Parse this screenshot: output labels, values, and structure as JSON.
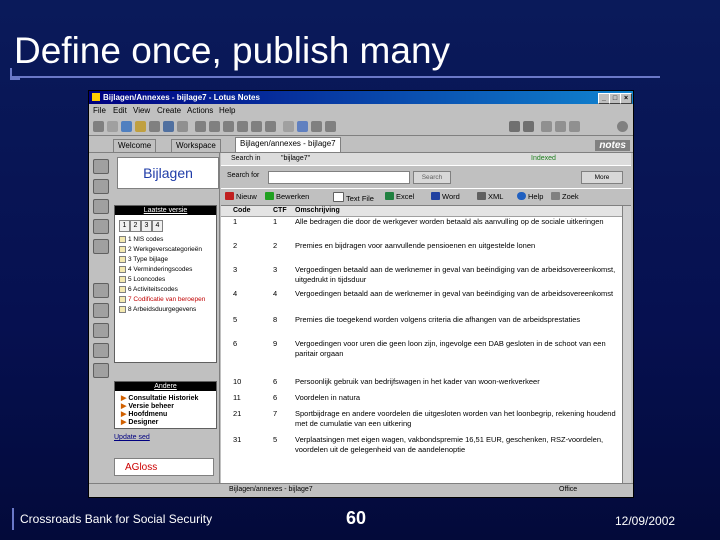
{
  "slide": {
    "title": "Define once, publish many",
    "footer_left": "Crossroads Bank for Social Security",
    "page_number": "60",
    "date": "12/09/2002"
  },
  "window": {
    "title": "Bijlagen/Annexes - bijlage7 - Lotus Notes",
    "menu": [
      "File",
      "Edit",
      "View",
      "Create",
      "Actions",
      "Help"
    ],
    "brand": "notes",
    "tabs": [
      "Welcome",
      "Workspace",
      "Bijlagen/annexes - bijlage7"
    ]
  },
  "nav": {
    "logo": "Bijlagen",
    "panel_title": "Laatste versie",
    "vtabs": [
      "1",
      "2",
      "3",
      "4"
    ],
    "items": [
      "1 NIS codes",
      "2 Werkgeverscategorieën",
      "3 Type bijlage",
      "4 Verminderingscodes",
      "5 Looncodes",
      "6 Activiteitscodes",
      "7 Codificatie van beroepen",
      "8 Arbeidsduurgegevens"
    ],
    "other_title": "Andere",
    "other_items": [
      "Consultatie Historiek",
      "Versie beheer",
      "Hoofdmenu",
      "Designer"
    ],
    "update_link": "Update sed",
    "agloss": "AGloss"
  },
  "content": {
    "search_label": "Search in",
    "search_scope": "\"bijlage7\"",
    "indexed": "Indexed",
    "search_for_label": "Search for",
    "search_button": "Search",
    "more_button": "More",
    "actions": [
      "Nieuw",
      "Bewerken",
      "Text File",
      "Excel",
      "Word",
      "XML",
      "Help",
      "Zoek"
    ],
    "columns": [
      "Code",
      "CTF",
      "Omschrijving"
    ],
    "rows": [
      {
        "code": "1",
        "ctf": "1",
        "desc": "Alle bedragen die door de werkgever worden betaald als aanvulling op de sociale uitkeringen"
      },
      {
        "code": "2",
        "ctf": "2",
        "desc": "Premies en bijdragen voor aanvullende pensioenen en uitgestelde lonen"
      },
      {
        "code": "3",
        "ctf": "3",
        "desc": "Vergoedingen betaald aan de werknemer in geval van beëindiging van de arbeidsovereenkomst, uitgedrukt in tijdsduur"
      },
      {
        "code": "4",
        "ctf": "4",
        "desc": "Vergoedingen betaald aan de werknemer in geval van beëindiging van de arbeidsovereenkomst"
      },
      {
        "code": "5",
        "ctf": "8",
        "desc": "Premies die toegekend worden volgens criteria die afhangen van de arbeidsprestaties"
      },
      {
        "code": "6",
        "ctf": "9",
        "desc": "Vergoedingen voor uren die geen loon zijn, ingevolge een DAB gesloten in de schoot van een paritair orgaan"
      },
      {
        "code": "10",
        "ctf": "6",
        "desc": "Persoonlijk gebruik van bedrijfswagen in het kader van woon-werkverkeer"
      },
      {
        "code": "11",
        "ctf": "6",
        "desc": "Voordelen in natura"
      },
      {
        "code": "21",
        "ctf": "7",
        "desc": "Sportbijdrage en andere voordelen die uitgesloten worden van het loonbegrip, rekening houdend met de cumulatie van een uitkering"
      },
      {
        "code": "31",
        "ctf": "5",
        "desc": "Verplaatsingen met eigen wagen, vakbondspremie 16,51 EUR, geschenken, RSZ-voordelen, voordelen uit de gelegenheid van de aandelenoptie"
      }
    ]
  },
  "status": {
    "path": "Bijlagen/annexes - bijlage7",
    "office": "Office"
  },
  "colors": {
    "slide_bg": "#061050",
    "accent": "#6a78c8",
    "titlebar": "#000080",
    "logo_text": "#1f3ca8",
    "selected_item": "#c00000"
  }
}
